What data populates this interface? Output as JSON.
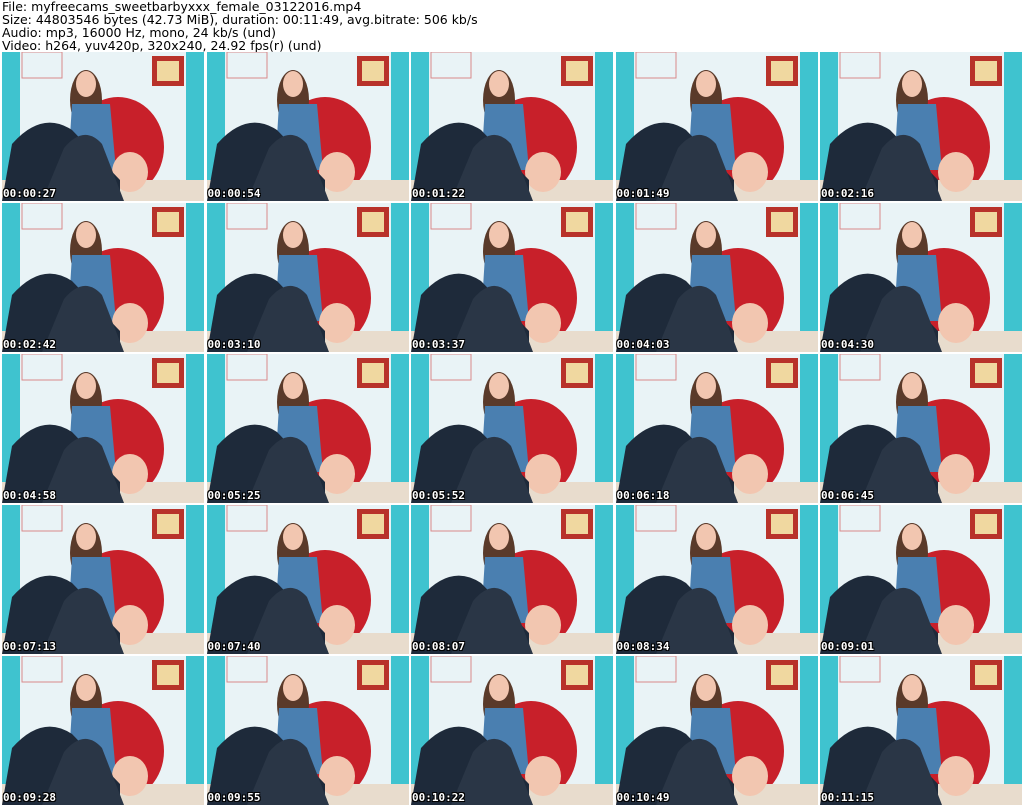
{
  "header": {
    "file_line": "File: myfreecams_sweetbarbyxxx_female_03122016.mp4",
    "size_line": "Size: 44803546 bytes (42.73 MiB), duration: 00:11:49, avg.bitrate: 506 kb/s",
    "audio_line": "Audio: mp3, 16000 Hz, mono, 24 kb/s (und)",
    "video_line": "Video: h264, yuv420p, 320x240, 24.92 fps(r) (und)"
  },
  "colors": {
    "wall": "#e9f3f6",
    "teal_panel": "#3fc3cf",
    "red_pillow": "#c8202a",
    "hair": "#5a3a2a",
    "skin": "#f2c6b0",
    "stockings": "#1e2a3a",
    "top": "#4a7fb0",
    "floor": "#e8dccd",
    "frame": "#b8322a"
  },
  "thumbnails": [
    {
      "timestamp": "00:00:27"
    },
    {
      "timestamp": "00:00:54"
    },
    {
      "timestamp": "00:01:22"
    },
    {
      "timestamp": "00:01:49"
    },
    {
      "timestamp": "00:02:16"
    },
    {
      "timestamp": "00:02:42"
    },
    {
      "timestamp": "00:03:10"
    },
    {
      "timestamp": "00:03:37"
    },
    {
      "timestamp": "00:04:03"
    },
    {
      "timestamp": "00:04:30"
    },
    {
      "timestamp": "00:04:58"
    },
    {
      "timestamp": "00:05:25"
    },
    {
      "timestamp": "00:05:52"
    },
    {
      "timestamp": "00:06:18"
    },
    {
      "timestamp": "00:06:45"
    },
    {
      "timestamp": "00:07:13"
    },
    {
      "timestamp": "00:07:40"
    },
    {
      "timestamp": "00:08:07"
    },
    {
      "timestamp": "00:08:34"
    },
    {
      "timestamp": "00:09:01"
    },
    {
      "timestamp": "00:09:28"
    },
    {
      "timestamp": "00:09:55"
    },
    {
      "timestamp": "00:10:22"
    },
    {
      "timestamp": "00:10:49"
    },
    {
      "timestamp": "00:11:15"
    }
  ]
}
